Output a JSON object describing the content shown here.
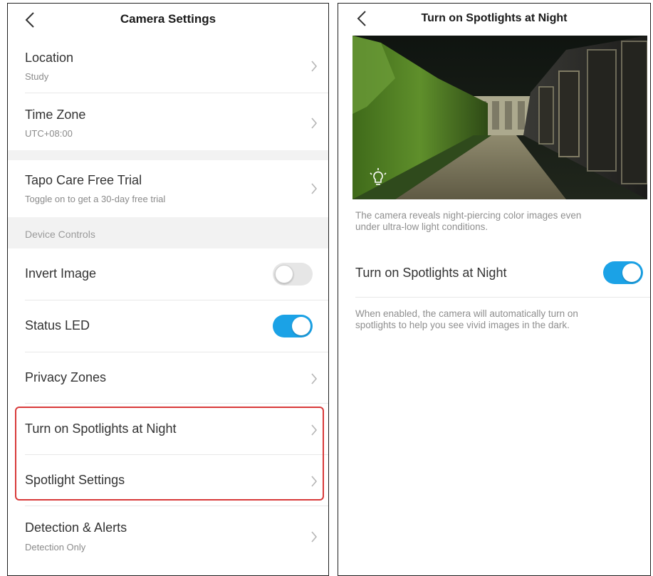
{
  "left": {
    "title": "Camera Settings",
    "items": [
      {
        "label": "Location",
        "sub": "Study"
      },
      {
        "label": "Time Zone",
        "sub": "UTC+08:00"
      },
      {
        "label": "Tapo Care Free Trial",
        "sub": "Toggle on to get a 30-day free trial"
      }
    ],
    "section_header": "Device Controls",
    "controls": {
      "invert_image": {
        "label": "Invert Image",
        "state": "off"
      },
      "status_led": {
        "label": "Status LED",
        "state": "on"
      },
      "privacy_zones": {
        "label": "Privacy Zones"
      },
      "spotlights_night": {
        "label": "Turn on Spotlights at Night"
      },
      "spotlight_settings": {
        "label": "Spotlight Settings"
      },
      "detection": {
        "label": "Detection & Alerts",
        "sub": "Detection Only"
      }
    }
  },
  "right": {
    "title": "Turn on Spotlights at Night",
    "desc1_line1": "The camera reveals night-piercing color images even",
    "desc1_line2": "under ultra-low light conditions.",
    "toggle_label": "Turn on Spotlights at Night",
    "toggle_state": "on",
    "desc2_line1": "When enabled, the camera will automatically turn on",
    "desc2_line2": "spotlights to help you see vivid images in the dark."
  },
  "colors": {
    "accent": "#1ba2e6",
    "highlight": "#d83a3a",
    "section_bg": "#f2f2f2"
  },
  "icons": [
    "chevron-left-icon",
    "chevron-right-icon",
    "light-bulb-icon"
  ]
}
